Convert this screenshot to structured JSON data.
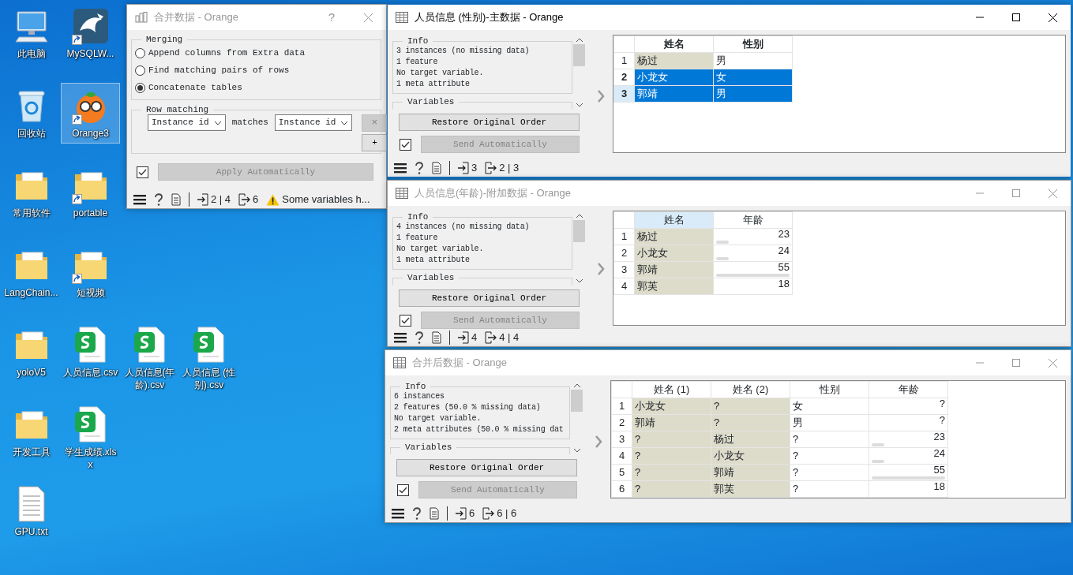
{
  "desktop": {
    "icon_rows": [
      [
        {
          "label": "此电脑",
          "kind": "computer",
          "shortcut": false,
          "selected": false
        },
        {
          "label": "MySQLW...",
          "kind": "app",
          "shortcut": true,
          "selected": false
        }
      ],
      [
        {
          "label": "回收站",
          "kind": "recycle-bin",
          "shortcut": false,
          "selected": false
        },
        {
          "label": "Orange3",
          "kind": "orange",
          "shortcut": true,
          "selected": true
        }
      ],
      [
        {
          "label": "常用软件",
          "kind": "folder",
          "shortcut": false,
          "selected": false
        },
        {
          "label": "portable",
          "kind": "folder",
          "shortcut": true,
          "selected": false
        }
      ],
      [
        {
          "label": "LangChain...",
          "kind": "folder",
          "shortcut": false,
          "selected": false
        },
        {
          "label": "短视频",
          "kind": "folder",
          "shortcut": true,
          "selected": false
        }
      ],
      [
        {
          "label": "yoloV5",
          "kind": "folder",
          "shortcut": false,
          "selected": false
        },
        {
          "label": "人员信息.csv",
          "kind": "sheet",
          "shortcut": false,
          "selected": false
        },
        {
          "label": "人员信息(年龄).csv",
          "kind": "sheet",
          "shortcut": false,
          "selected": false
        },
        {
          "label": "人员信息 (性别).csv",
          "kind": "sheet",
          "shortcut": false,
          "selected": false
        }
      ],
      [
        {
          "label": "开发工具",
          "kind": "folder",
          "shortcut": false,
          "selected": false
        },
        {
          "label": "学生成绩.xlsx",
          "kind": "sheet",
          "shortcut": false,
          "selected": false
        }
      ],
      [
        {
          "label": "GPU.txt",
          "kind": "text-file",
          "shortcut": false,
          "selected": false
        }
      ]
    ]
  },
  "merge_dialog": {
    "title": "合并数据 - Orange",
    "active": false,
    "help": "?",
    "merging": {
      "legend": "Merging",
      "options": [
        {
          "label": "Append columns from Extra data",
          "selected": false
        },
        {
          "label": "Find matching pairs of rows",
          "selected": false
        },
        {
          "label": "Concatenate tables",
          "selected": true
        }
      ]
    },
    "row_matching": {
      "legend": "Row matching",
      "left": "Instance id",
      "connector": "matches",
      "right": "Instance id",
      "remove_button": {
        "label": "×",
        "disabled": true
      },
      "add_button": {
        "label": "+",
        "disabled": false
      }
    },
    "apply": {
      "checked": true,
      "label": "Apply Automatically",
      "disabled": true
    },
    "status": {
      "input": "2 | 4",
      "output": "6",
      "warning": "Some variables h..."
    }
  },
  "table_windows": [
    {
      "title": "人员信息 (性别)-主数据 - Orange",
      "active": true,
      "info": {
        "legend": "Info",
        "lines": [
          "3 instances (no missing data)",
          "1  feature",
          "No target variable.",
          "1 meta attribute"
        ]
      },
      "variables_legend": "Variables",
      "restore_button": "Restore Original Order",
      "send": {
        "checked": true,
        "label": "Send Automatically",
        "disabled": true
      },
      "table": {
        "columns": [
          {
            "label": "姓名",
            "selected": true,
            "current": false
          },
          {
            "label": "性别",
            "selected": true,
            "current": false
          }
        ],
        "rows": [
          {
            "header": "1",
            "selected": false,
            "current": false,
            "cells": [
              {
                "text": "杨过",
                "kind": "meta"
              },
              {
                "text": "男",
                "kind": "plain"
              }
            ]
          },
          {
            "header": "2",
            "selected": true,
            "current": false,
            "cells": [
              {
                "text": "小龙女",
                "kind": "meta"
              },
              {
                "text": "女",
                "kind": "plain"
              }
            ]
          },
          {
            "header": "3",
            "selected": true,
            "current": true,
            "cells": [
              {
                "text": "郭靖",
                "kind": "meta"
              },
              {
                "text": "男",
                "kind": "plain"
              }
            ]
          }
        ]
      },
      "status": {
        "input": "3",
        "output": "2 | 3"
      }
    },
    {
      "title": "人员信息(年龄)-附加数据 - Orange",
      "active": false,
      "info": {
        "legend": "Info",
        "lines": [
          "4 instances (no missing data)",
          "1  feature",
          "No target variable.",
          "1 meta attribute"
        ]
      },
      "variables_legend": "Variables",
      "restore_button": "Restore Original Order",
      "send": {
        "checked": true,
        "label": "Send Automatically",
        "disabled": true
      },
      "table": {
        "columns": [
          {
            "label": "姓名",
            "selected": false,
            "current": true
          },
          {
            "label": "年龄",
            "selected": false,
            "current": false
          }
        ],
        "rows": [
          {
            "header": "1",
            "selected": false,
            "current": false,
            "cells": [
              {
                "text": "杨过",
                "kind": "meta"
              },
              {
                "text": "23",
                "kind": "numeric",
                "level": 0.17
              }
            ]
          },
          {
            "header": "2",
            "selected": false,
            "current": false,
            "cells": [
              {
                "text": "小龙女",
                "kind": "meta"
              },
              {
                "text": "24",
                "kind": "numeric",
                "level": 0.17
              }
            ]
          },
          {
            "header": "3",
            "selected": false,
            "current": false,
            "cells": [
              {
                "text": "郭靖",
                "kind": "meta"
              },
              {
                "text": "55",
                "kind": "numeric",
                "level": 1
              }
            ]
          },
          {
            "header": "4",
            "selected": false,
            "current": false,
            "cells": [
              {
                "text": "郭芙",
                "kind": "meta"
              },
              {
                "text": "18",
                "kind": "numeric"
              }
            ]
          }
        ]
      },
      "status": {
        "input": "4",
        "output": "4 | 4"
      }
    },
    {
      "title": "合并后数据 - Orange",
      "active": false,
      "info": {
        "legend": "Info",
        "lines": [
          "6 instances",
          "2  features (50.0 % missing data)",
          "No target variable.",
          "2 meta attributes (50.0 % missing dat"
        ]
      },
      "variables_legend": "Variables",
      "restore_button": "Restore Original Order",
      "send": {
        "checked": true,
        "label": "Send Automatically",
        "disabled": true
      },
      "table": {
        "columns": [
          {
            "label": "姓名 (1)",
            "selected": false,
            "current": false
          },
          {
            "label": "姓名 (2)",
            "selected": false,
            "current": false
          },
          {
            "label": "性别",
            "selected": false,
            "current": false
          },
          {
            "label": "年龄",
            "selected": false,
            "current": false
          }
        ],
        "rows": [
          {
            "header": "1",
            "selected": false,
            "current": false,
            "cells": [
              {
                "text": "小龙女",
                "kind": "meta"
              },
              {
                "text": "?",
                "kind": "meta"
              },
              {
                "text": "女",
                "kind": "plain"
              },
              {
                "text": "?",
                "kind": "numeric"
              }
            ]
          },
          {
            "header": "2",
            "selected": false,
            "current": false,
            "cells": [
              {
                "text": "郭靖",
                "kind": "meta"
              },
              {
                "text": "?",
                "kind": "meta"
              },
              {
                "text": "男",
                "kind": "plain"
              },
              {
                "text": "?",
                "kind": "numeric"
              }
            ]
          },
          {
            "header": "3",
            "selected": false,
            "current": false,
            "cells": [
              {
                "text": "?",
                "kind": "meta"
              },
              {
                "text": "杨过",
                "kind": "meta"
              },
              {
                "text": "?",
                "kind": "plain"
              },
              {
                "text": "23",
                "kind": "numeric",
                "level": 0.17
              }
            ]
          },
          {
            "header": "4",
            "selected": false,
            "current": false,
            "cells": [
              {
                "text": "?",
                "kind": "meta"
              },
              {
                "text": "小龙女",
                "kind": "meta"
              },
              {
                "text": "?",
                "kind": "plain"
              },
              {
                "text": "24",
                "kind": "numeric",
                "level": 0.17
              }
            ]
          },
          {
            "header": "5",
            "selected": false,
            "current": false,
            "cells": [
              {
                "text": "?",
                "kind": "meta"
              },
              {
                "text": "郭靖",
                "kind": "meta"
              },
              {
                "text": "?",
                "kind": "plain"
              },
              {
                "text": "55",
                "kind": "numeric",
                "level": 1
              }
            ]
          },
          {
            "header": "6",
            "selected": false,
            "current": false,
            "cells": [
              {
                "text": "?",
                "kind": "meta"
              },
              {
                "text": "郭芙",
                "kind": "meta"
              },
              {
                "text": "?",
                "kind": "plain"
              },
              {
                "text": "18",
                "kind": "numeric"
              }
            ]
          }
        ]
      },
      "status": {
        "input": "6",
        "output": "6 | 6"
      }
    }
  ]
}
